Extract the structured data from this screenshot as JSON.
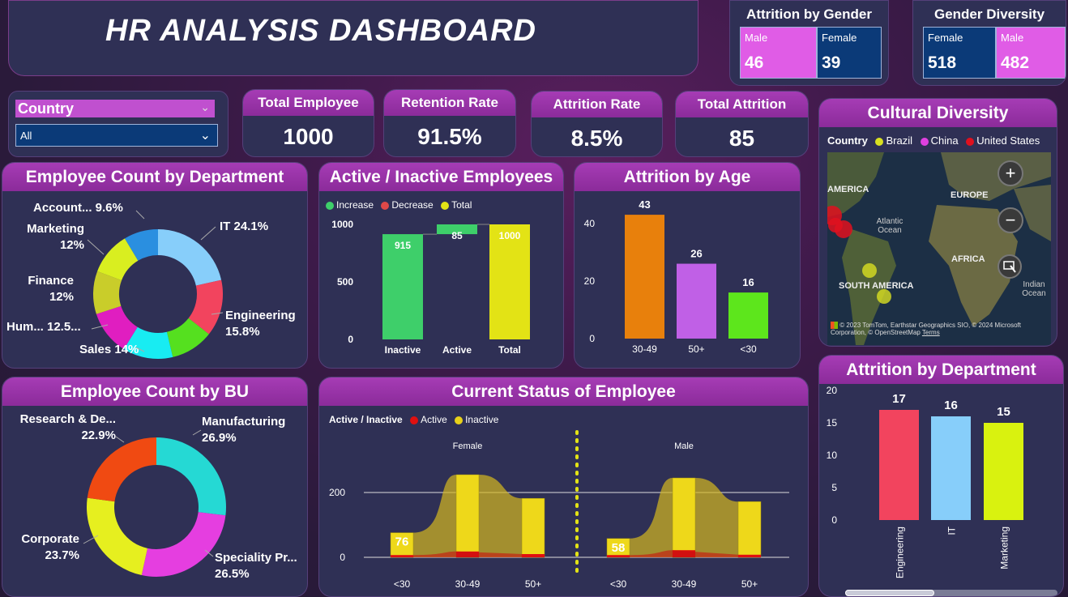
{
  "title": "HR ANALYSIS DASHBOARD",
  "attrition_by_gender": {
    "title": "Attrition by Gender",
    "tiles": [
      {
        "label": "Male",
        "value": "46",
        "color": "#e05ce6"
      },
      {
        "label": "Female",
        "value": "39",
        "color": "#0b3a78"
      }
    ]
  },
  "gender_diversity": {
    "title": "Gender Diversity",
    "tiles": [
      {
        "label": "Female",
        "value": "518",
        "color": "#0b3a78"
      },
      {
        "label": "Male",
        "value": "482",
        "color": "#e05ce6"
      }
    ]
  },
  "filter": {
    "label": "Country",
    "selected": "All"
  },
  "kpis": [
    {
      "label": "Total Employee",
      "value": "1000"
    },
    {
      "label": "Retention Rate",
      "value": "91.5%"
    },
    {
      "label": "Attrition Rate",
      "value": "8.5%"
    },
    {
      "label": "Total Attrition",
      "value": "85"
    }
  ],
  "cultural_diversity": {
    "title": "Cultural Diversity",
    "legend_title": "Country",
    "legend": [
      {
        "name": "Brazil",
        "color": "#d9e021"
      },
      {
        "name": "China",
        "color": "#e040e0"
      },
      {
        "name": "United States",
        "color": "#e0101e"
      }
    ],
    "map_labels": {
      "america": "AMERICA",
      "europe": "EUROPE",
      "atlantic": "Atlantic Ocean",
      "africa": "AFRICA",
      "south_america": "SOUTH AMERICA",
      "indian": "Indian Ocean"
    },
    "attribution": "© 2023 TomTom, Earthstar Geographics SIO, © 2024 Microsoft Corporation, © OpenStreetMap",
    "terms": "Terms",
    "controls": {
      "zoom_in": "+",
      "zoom_out": "−"
    }
  },
  "dept_count": {
    "title": "Employee Count by Department"
  },
  "active_inactive": {
    "title": "Active / Inactive Employees"
  },
  "attrition_age": {
    "title": "Attrition by Age"
  },
  "bu_count": {
    "title": "Employee Count by BU"
  },
  "current_status": {
    "title": "Current Status of Employee"
  },
  "attrition_dept": {
    "title": "Attrition by Department"
  },
  "chart_data": [
    {
      "type": "pie",
      "donut": true,
      "title": "Employee Count by Department",
      "slices": [
        {
          "label": "IT",
          "value": 24.1,
          "text": "IT 24.1%",
          "color": "#87cefa"
        },
        {
          "label": "Engineering",
          "value": 15.8,
          "text": "Engineering 15.8%",
          "color": "#f2445e"
        },
        {
          "label": "",
          "value": 12.0,
          "text": "",
          "color": "#55e01f"
        },
        {
          "label": "Sales",
          "value": 14.0,
          "text": "Sales 14%",
          "color": "#18ecf2"
        },
        {
          "label": "Hum...",
          "value": 12.5,
          "text": "Hum... 12.5...",
          "color": "#e01ec0"
        },
        {
          "label": "Finance",
          "value": 12.0,
          "text": "Finance 12%",
          "color": "#c9cd2a"
        },
        {
          "label": "Marketing",
          "value": 12.0,
          "text": "Marketing 12%",
          "color": "#d9ee20"
        },
        {
          "label": "Account...",
          "value": 9.6,
          "text": "Account... 9.6%",
          "color": "#2a8fe0"
        }
      ]
    },
    {
      "type": "bar",
      "subtype": "waterfall",
      "title": "Active / Inactive Employees",
      "legend": [
        {
          "name": "Increase",
          "color": "#3ecf6a"
        },
        {
          "name": "Decrease",
          "color": "#e04848"
        },
        {
          "name": "Total",
          "color": "#e3e315"
        }
      ],
      "categories": [
        "Inactive",
        "Active",
        "Total"
      ],
      "bars": [
        {
          "start": 0,
          "end": 915,
          "label": "915",
          "color": "#3ecf6a"
        },
        {
          "start": 915,
          "end": 1000,
          "label": "85",
          "color": "#3ecf6a"
        },
        {
          "start": 0,
          "end": 1000,
          "label": "1000",
          "color": "#e3e315"
        }
      ],
      "yticks": [
        0,
        500,
        1000
      ],
      "ylim": [
        0,
        1000
      ]
    },
    {
      "type": "bar",
      "title": "Attrition by Age",
      "categories": [
        "30-49",
        "50+",
        "<30"
      ],
      "values": [
        43,
        26,
        16
      ],
      "colors": [
        "#e8800c",
        "#c060e6",
        "#5de61c"
      ],
      "yticks": [
        0,
        20,
        40
      ],
      "ylim": [
        0,
        45
      ]
    },
    {
      "type": "pie",
      "donut": true,
      "title": "Employee Count by BU",
      "slices": [
        {
          "label": "Manufacturing",
          "value": 26.9,
          "text": "Manufacturing 26.9%",
          "color": "#25d9d4"
        },
        {
          "label": "Speciality Pr...",
          "value": 26.5,
          "text": "Speciality Pr... 26.5%",
          "color": "#e53ee0"
        },
        {
          "label": "Corporate",
          "value": 23.7,
          "text": "Corporate 23.7%",
          "color": "#e6ef1f"
        },
        {
          "label": "Research & De...",
          "value": 22.9,
          "text": "Research & De... 22.9%",
          "color": "#f04a12"
        }
      ]
    },
    {
      "type": "area",
      "title": "Current Status of Employee",
      "legend_title": "Active / Inactive",
      "legend": [
        {
          "name": "Active",
          "color": "#e01010"
        },
        {
          "name": "Inactive",
          "color": "#e8d11a"
        }
      ],
      "panels": [
        {
          "name": "Female",
          "categories": [
            "<30",
            "30-49",
            "50+"
          ],
          "inactive": [
            76,
            255,
            182
          ],
          "active": [
            7,
            18,
            10
          ],
          "label_first": "76"
        },
        {
          "name": "Male",
          "categories": [
            "<30",
            "30-49",
            "50+"
          ],
          "inactive": [
            58,
            245,
            172
          ],
          "active": [
            7,
            22,
            8
          ],
          "label_first": "58"
        }
      ],
      "yticks": [
        0,
        200
      ]
    },
    {
      "type": "bar",
      "title": "Attrition by Department",
      "categories": [
        "Engineering",
        "IT",
        "Marketing"
      ],
      "values": [
        17,
        16,
        15
      ],
      "colors": [
        "#f2445e",
        "#87cefa",
        "#d9f20f"
      ],
      "yticks": [
        0,
        5,
        10,
        15,
        20
      ],
      "ylim": [
        0,
        20
      ]
    }
  ]
}
